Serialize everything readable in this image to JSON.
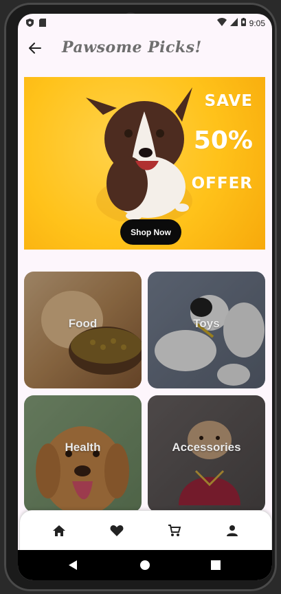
{
  "status_bar": {
    "time": "9:05",
    "icons": [
      "shield-icon",
      "sim-card-icon",
      "wifi-icon",
      "signal-icon",
      "battery-icon"
    ]
  },
  "app_bar": {
    "title": "Pawsome Picks!",
    "back_icon": "arrow-left-icon"
  },
  "banner": {
    "line1": "SAVE",
    "line2": "50%",
    "line3": "OFFER",
    "button_label": "Shop Now",
    "bg_color": "#ffc21a"
  },
  "categories": [
    {
      "label": "Food"
    },
    {
      "label": "Toys"
    },
    {
      "label": "Health"
    },
    {
      "label": "Accessories"
    }
  ],
  "bottom_nav": {
    "items": [
      "home-icon",
      "favorite-icon",
      "cart-icon",
      "profile-icon"
    ]
  },
  "system_nav": {
    "items": [
      "back-triangle-icon",
      "home-circle-icon",
      "recents-square-icon"
    ]
  }
}
